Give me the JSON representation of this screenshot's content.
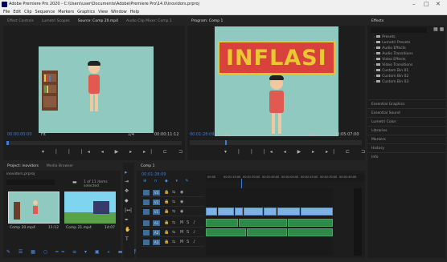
{
  "window": {
    "title": "Adobe Premiere Pro 2020 - C:\\Users\\user\\Documents\\Adobe\\Premiere Pro\\14.0\\inovidors.prproj",
    "minimize": "–",
    "maximize": "□",
    "close": "✕"
  },
  "menu": [
    "File",
    "Edit",
    "Clip",
    "Sequence",
    "Markers",
    "Graphics",
    "View",
    "Window",
    "Help"
  ],
  "source_panel": {
    "tabs": [
      "Effect Controls",
      "Lumetri Scopes",
      "Source: Comp 20.mp4",
      "Audio Clip Mixer: Comp 1"
    ],
    "active_tab": 2,
    "timecode": "00:00:00:00",
    "fit": "Fit",
    "scale": "1/4",
    "duration": "00:00:11:12"
  },
  "program_panel": {
    "tab": "Program: Comp 1",
    "title_text": "INFLASI",
    "timecode": "00:01:28:09",
    "fit": "Fit",
    "scale": "1/2",
    "duration": "00:05:07:00"
  },
  "effects_panel": {
    "tab": "Effects",
    "items": [
      "Presets",
      "Lumetri Presets",
      "Audio Effects",
      "Audio Transitions",
      "Video Effects",
      "Video Transitions",
      "Custom Bin 01",
      "Custom Bin 02",
      "Custom Bin 03"
    ],
    "sections": [
      "Essential Graphics",
      "Essential Sound",
      "Lumetri Color",
      "Libraries",
      "Markers",
      "History",
      "Info"
    ]
  },
  "project_panel": {
    "tabs": [
      "Project: inovidors",
      "Media Browser"
    ],
    "project_file": "inovidors.prproj",
    "items_count": "1 of 11 items selected",
    "thumbs": [
      {
        "name": "Comp 20.mp4",
        "duration": "11:12"
      },
      {
        "name": "Comp 21.mp4",
        "duration": "14:07"
      }
    ]
  },
  "timeline": {
    "tab": "Comp 1",
    "timecode": "00:01:28:09",
    "ruler": [
      "00:00",
      "00:01:15:00",
      "00:01:30:00",
      "00:01:45:00",
      "00:02:00:00",
      "00:02:15:00",
      "00:02:30:00",
      "00:02:45:00"
    ],
    "video_tracks": [
      "V3",
      "V2",
      "V1"
    ],
    "audio_tracks": [
      "A1",
      "A2",
      "A3"
    ]
  },
  "colors": {
    "accent": "#3d7bd8",
    "title_red": "#d8413c",
    "title_yellow": "#e9c832",
    "canvas_teal": "#8fc9bf"
  }
}
